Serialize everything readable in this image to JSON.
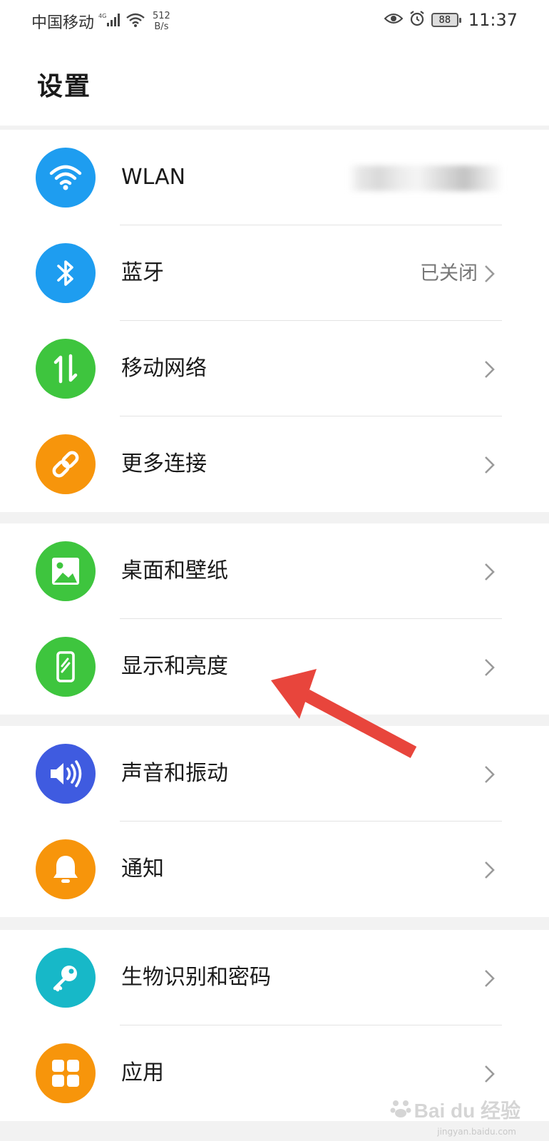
{
  "status_bar": {
    "carrier": "中国移动",
    "network_type": "4G",
    "speed_value": "512",
    "speed_unit": "B/s",
    "battery": "88",
    "time": "11:37"
  },
  "header": {
    "title": "设置"
  },
  "groups": [
    {
      "items": [
        {
          "label": "WLAN",
          "value": "",
          "icon": "wifi-icon",
          "color": "#1e9df0"
        },
        {
          "label": "蓝牙",
          "value": "已关闭",
          "icon": "bluetooth-icon",
          "color": "#1e9df0"
        },
        {
          "label": "移动网络",
          "value": "",
          "icon": "mobile-data-icon",
          "color": "#3ec53e"
        },
        {
          "label": "更多连接",
          "value": "",
          "icon": "link-icon",
          "color": "#f7950b"
        }
      ]
    },
    {
      "items": [
        {
          "label": "桌面和壁纸",
          "value": "",
          "icon": "image-icon",
          "color": "#3ec53e"
        },
        {
          "label": "显示和亮度",
          "value": "",
          "icon": "phone-display-icon",
          "color": "#3ec53e"
        }
      ]
    },
    {
      "items": [
        {
          "label": "声音和振动",
          "value": "",
          "icon": "speaker-icon",
          "color": "#3f5be0"
        },
        {
          "label": "通知",
          "value": "",
          "icon": "bell-icon",
          "color": "#f7950b"
        }
      ]
    },
    {
      "items": [
        {
          "label": "生物识别和密码",
          "value": "",
          "icon": "key-icon",
          "color": "#17b8c8"
        },
        {
          "label": "应用",
          "value": "",
          "icon": "apps-grid-icon",
          "color": "#f7950b"
        }
      ]
    }
  ],
  "annotation": {
    "arrow_color": "#e8453c"
  },
  "watermark": {
    "brand": "Bai du 经验",
    "url": "jingyan.baidu.com"
  }
}
